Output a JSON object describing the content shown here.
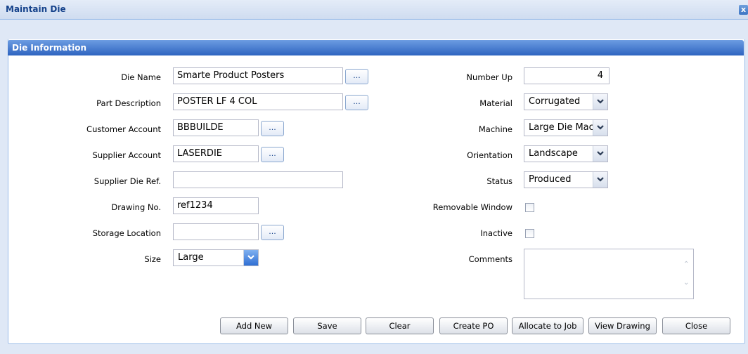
{
  "window": {
    "title": "Maintain Die",
    "close_glyph": "x"
  },
  "panel": {
    "title": "Die Information"
  },
  "left": {
    "die_name": {
      "label": "Die Name",
      "value": "Smarte Product Posters",
      "lookup": "..."
    },
    "part_description": {
      "label": "Part Description",
      "value": "POSTER LF 4 COL",
      "lookup": "..."
    },
    "customer_account": {
      "label": "Customer Account",
      "value": "BBBUILDE",
      "lookup": "..."
    },
    "supplier_account": {
      "label": "Supplier Account",
      "value": "LASERDIE",
      "lookup": "..."
    },
    "supplier_die_ref": {
      "label": "Supplier Die Ref.",
      "value": ""
    },
    "drawing_no": {
      "label": "Drawing No.",
      "value": "ref1234"
    },
    "storage_location": {
      "label": "Storage Location",
      "value": "",
      "lookup": "..."
    },
    "size": {
      "label": "Size",
      "value": "Large"
    }
  },
  "right": {
    "number_up": {
      "label": "Number Up",
      "value": "4"
    },
    "material": {
      "label": "Material",
      "value": "Corrugated"
    },
    "machine": {
      "label": "Machine",
      "value": "Large Die Mac"
    },
    "orientation": {
      "label": "Orientation",
      "value": "Landscape"
    },
    "status": {
      "label": "Status",
      "value": "Produced"
    },
    "removable_window": {
      "label": "Removable Window",
      "checked": false
    },
    "inactive": {
      "label": "Inactive",
      "checked": false
    },
    "comments": {
      "label": "Comments",
      "value": ""
    }
  },
  "buttons": {
    "add_new": "Add New",
    "save": "Save",
    "clear": "Clear",
    "create_po": "Create PO",
    "allocate": "Allocate to Job",
    "view_drawing": "View Drawing",
    "close": "Close"
  },
  "icons": {
    "dropdown": "chevron-down-icon",
    "window_close": "close-icon",
    "scroll_up": "scroll-up-icon",
    "scroll_down": "scroll-down-icon"
  }
}
